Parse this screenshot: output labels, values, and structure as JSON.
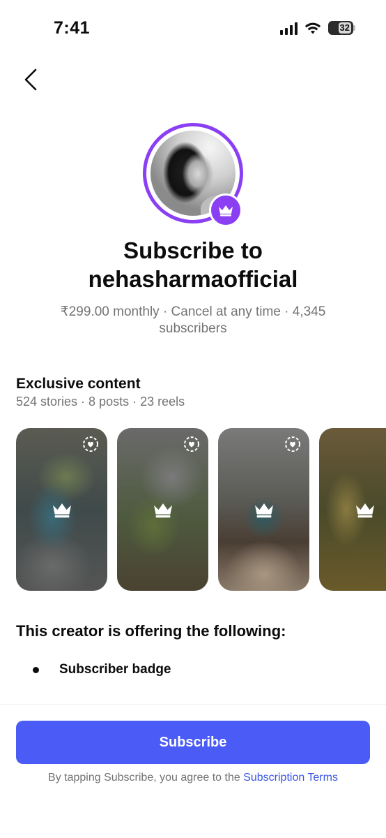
{
  "status_bar": {
    "time": "7:41",
    "battery_level": "32",
    "icons": [
      "cellular-signal-icon",
      "wifi-icon",
      "battery-icon"
    ]
  },
  "nav": {
    "back_icon": "chevron-left-icon"
  },
  "profile": {
    "badge_icon": "crown-icon",
    "accent_color": "#8a3ff3"
  },
  "header": {
    "title_line1": "Subscribe to",
    "title_line2": "nehasharmaofficial",
    "subtitle": "₹299.00 monthly · Cancel at any time · 4,345 subscribers"
  },
  "exclusive": {
    "heading": "Exclusive content",
    "counts": "524 stories · 8 posts · 23 reels",
    "cards": [
      {
        "icon": "crown-icon",
        "story_icon": "close-friends-story-icon"
      },
      {
        "icon": "crown-icon",
        "story_icon": "close-friends-story-icon"
      },
      {
        "icon": "crown-icon",
        "story_icon": "close-friends-story-icon"
      },
      {
        "icon": "crown-icon",
        "story_icon": null
      }
    ]
  },
  "offering": {
    "heading": "This creator is offering the following:",
    "items": [
      "Subscriber badge"
    ]
  },
  "footer": {
    "subscribe_label": "Subscribe",
    "terms_prefix": "By tapping Subscribe, you agree to the ",
    "terms_link": "Subscription Terms",
    "button_color": "#4a5cf5"
  }
}
